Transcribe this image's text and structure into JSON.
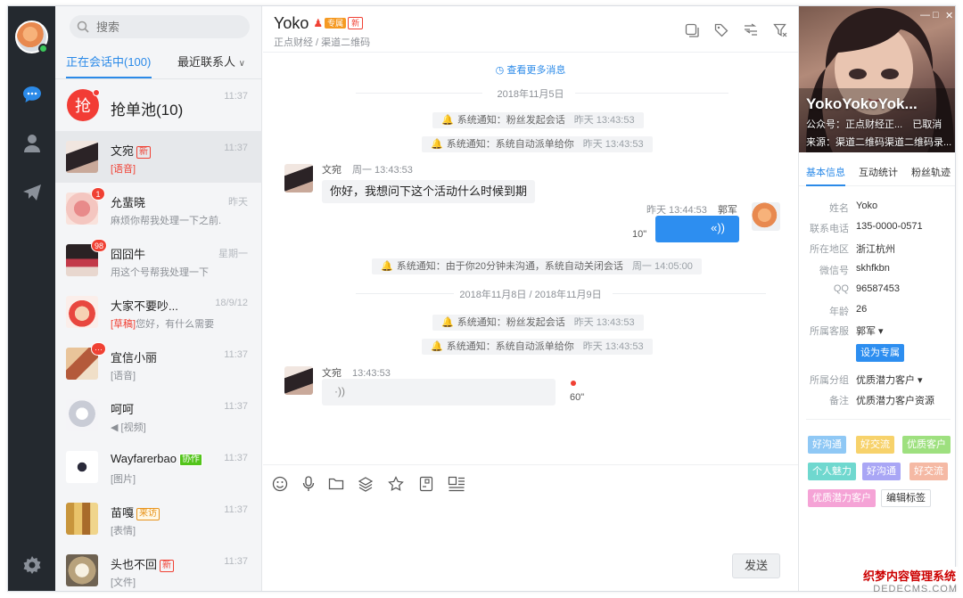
{
  "search": {
    "placeholder": "搜索"
  },
  "list_tabs": {
    "active": "正在会话中(100)",
    "recent": "最近联系人"
  },
  "pool": {
    "avatar_char": "抢",
    "name": "抢单池(10)",
    "time": "11:37"
  },
  "contacts": [
    {
      "name": "文宛",
      "tag": "新",
      "tag_kind": "new",
      "preview_hl": "[语音]",
      "preview": "",
      "time": "11:37",
      "badge": ""
    },
    {
      "name": "允蜚晓",
      "tag": "",
      "tag_kind": "",
      "preview_hl": "",
      "preview": "麻烦你帮我处理一下之前...",
      "time": "昨天",
      "badge": "1"
    },
    {
      "name": "囧囧牛",
      "tag": "",
      "tag_kind": "",
      "preview_hl": "",
      "preview": "用这个号帮我处理一下",
      "time": "星期一",
      "badge": "98"
    },
    {
      "name": "大家不要吵...",
      "tag": "",
      "tag_kind": "",
      "preview_hl": "[草稿]",
      "preview": "您好，有什么需要",
      "time": "18/9/12",
      "badge": ""
    },
    {
      "name": "宜信小丽",
      "tag": "",
      "tag_kind": "",
      "preview_hl": "",
      "preview": "[语音]",
      "time": "11:37",
      "badge": "···"
    },
    {
      "name": "呵呵",
      "tag": "",
      "tag_kind": "",
      "preview_hl": "",
      "preview": "◀ [视频]",
      "time": "11:37",
      "badge": ""
    },
    {
      "name": "Wayfarerbao",
      "tag": "协作",
      "tag_kind": "coop",
      "preview_hl": "",
      "preview": "[图片]",
      "time": "11:37",
      "badge": ""
    },
    {
      "name": "苗嘎",
      "tag": "来访",
      "tag_kind": "visit",
      "preview_hl": "",
      "preview": "[表情]",
      "time": "11:37",
      "badge": ""
    },
    {
      "name": "头也不回",
      "tag": "新",
      "tag_kind": "new",
      "preview_hl": "",
      "preview": "[文件]",
      "time": "11:37",
      "badge": ""
    }
  ],
  "chat_header": {
    "name": "Yoko",
    "tag1": "专属",
    "tag2": "新",
    "subtitle": "正点财经 / 渠道二维码"
  },
  "chat": {
    "more": "查看更多消息",
    "date1": "2018年11月5日",
    "sys1": {
      "text": "系统通知：粉丝发起会话",
      "time": "昨天 13:43:53"
    },
    "sys2": {
      "text": "系统通知：系统自动派单给你",
      "time": "昨天 13:43:53"
    },
    "m1": {
      "sender": "文宛",
      "time": "周一 13:43:53",
      "text": "你好，我想问下这个活动什么时候到期"
    },
    "m2": {
      "sender": "郭军",
      "time": "昨天 13:44:53",
      "duration": "10\""
    },
    "sys3": {
      "text": "系统通知：由于你20分钟未沟通，系统自动关闭会话",
      "time": "周一 14:05:00"
    },
    "date2": "2018年11月8日 / 2018年11月9日",
    "sys4": {
      "text": "系统通知：粉丝发起会话",
      "time": "昨天 13:43:53"
    },
    "sys5": {
      "text": "系统通知：系统自动派单给你",
      "time": "昨天 13:43:53"
    },
    "m3": {
      "sender": "文宛",
      "time": "13:43:53",
      "duration": "60\""
    }
  },
  "input": {
    "send": "发送"
  },
  "profile": {
    "name": "YokoYokoYok...",
    "line1": "公众号：正点财经正...",
    "line1_status": "已取消",
    "line2": "来源：渠道二维码渠道二维码录...",
    "tabs": [
      "基本信息",
      "互动统计",
      "粉丝轨迹"
    ],
    "fields": [
      {
        "k": "姓名",
        "v": "Yoko"
      },
      {
        "k": "联系电话",
        "v": "135-0000-0571"
      },
      {
        "k": "所在地区",
        "v": "浙江杭州"
      },
      {
        "k": "微信号",
        "v": "skhfkbn"
      },
      {
        "k": "QQ",
        "v": "96587453"
      },
      {
        "k": "年龄",
        "v": "26"
      },
      {
        "k": "所属客服",
        "v": "郭军 ▾"
      }
    ],
    "vip_button": "设为专属",
    "group": {
      "k": "所属分组",
      "v": "优质潜力客户 ▾"
    },
    "note": {
      "k": "备注",
      "v": "优质潜力客户资源"
    },
    "tags": [
      {
        "label": "好沟通",
        "color": "#8fc8f5"
      },
      {
        "label": "好交流",
        "color": "#f7d26b"
      },
      {
        "label": "优质客户",
        "color": "#9ee07f"
      },
      {
        "label": "个人魅力",
        "color": "#6fd8cf"
      },
      {
        "label": "好沟通",
        "color": "#a9a6f5"
      },
      {
        "label": "好交流",
        "color": "#f5b9a4"
      },
      {
        "label": "优质潜力客户",
        "color": "#f5a3d6"
      }
    ],
    "edit_tags": "编辑标签"
  },
  "watermark": {
    "line1": "织梦内容管理系统",
    "line2": "DEDECMS.COM"
  },
  "colors": {
    "accent": "#2b8ae8",
    "rail": "#24292f",
    "badge": "#f04134"
  }
}
